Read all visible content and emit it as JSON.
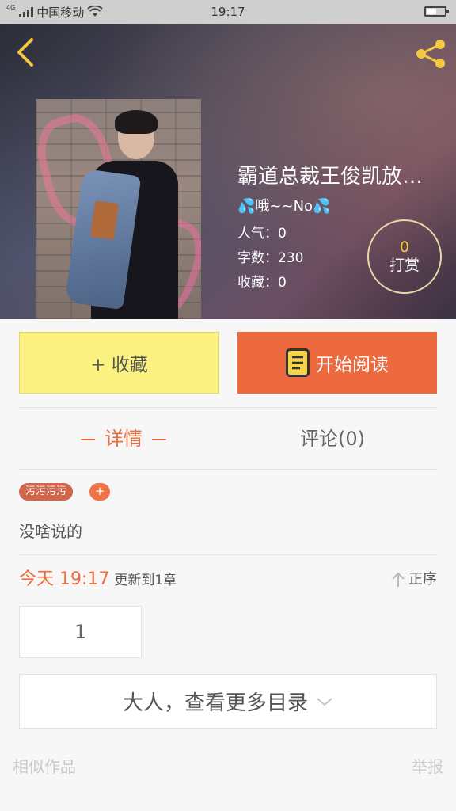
{
  "status_bar": {
    "network_badge": "4G",
    "carrier": "中国移动",
    "time": "19:17",
    "battery_level": 0.55
  },
  "header": {
    "back_icon": "chevron-left-icon",
    "share_icon": "share-icon",
    "accent_color": "#f5c842"
  },
  "book": {
    "title": "霸道总裁王俊凯放…",
    "author": "💦哦~~No💦",
    "popularity": "人气：0",
    "word_count": "字数：230",
    "favorites": "收藏：0",
    "tip_count": "0",
    "tip_label": "打赏"
  },
  "actions": {
    "favorite_label": "+ 收藏",
    "read_label": "开始阅读",
    "favorite_color": "#fbf281",
    "read_color": "#ec6a3d"
  },
  "tabs": {
    "detail": "详情",
    "comments": "评论(0)"
  },
  "tags": {
    "items": [
      "污污污污"
    ],
    "add_label": "+"
  },
  "description": "没啥说的",
  "update": {
    "date": "今天 19:17",
    "text": "更新到1章",
    "sort_label": "正序"
  },
  "chapters": {
    "first": "1",
    "more_label": "大人，查看更多目录"
  },
  "footer": {
    "similar": "相似作品",
    "report": "举报"
  }
}
